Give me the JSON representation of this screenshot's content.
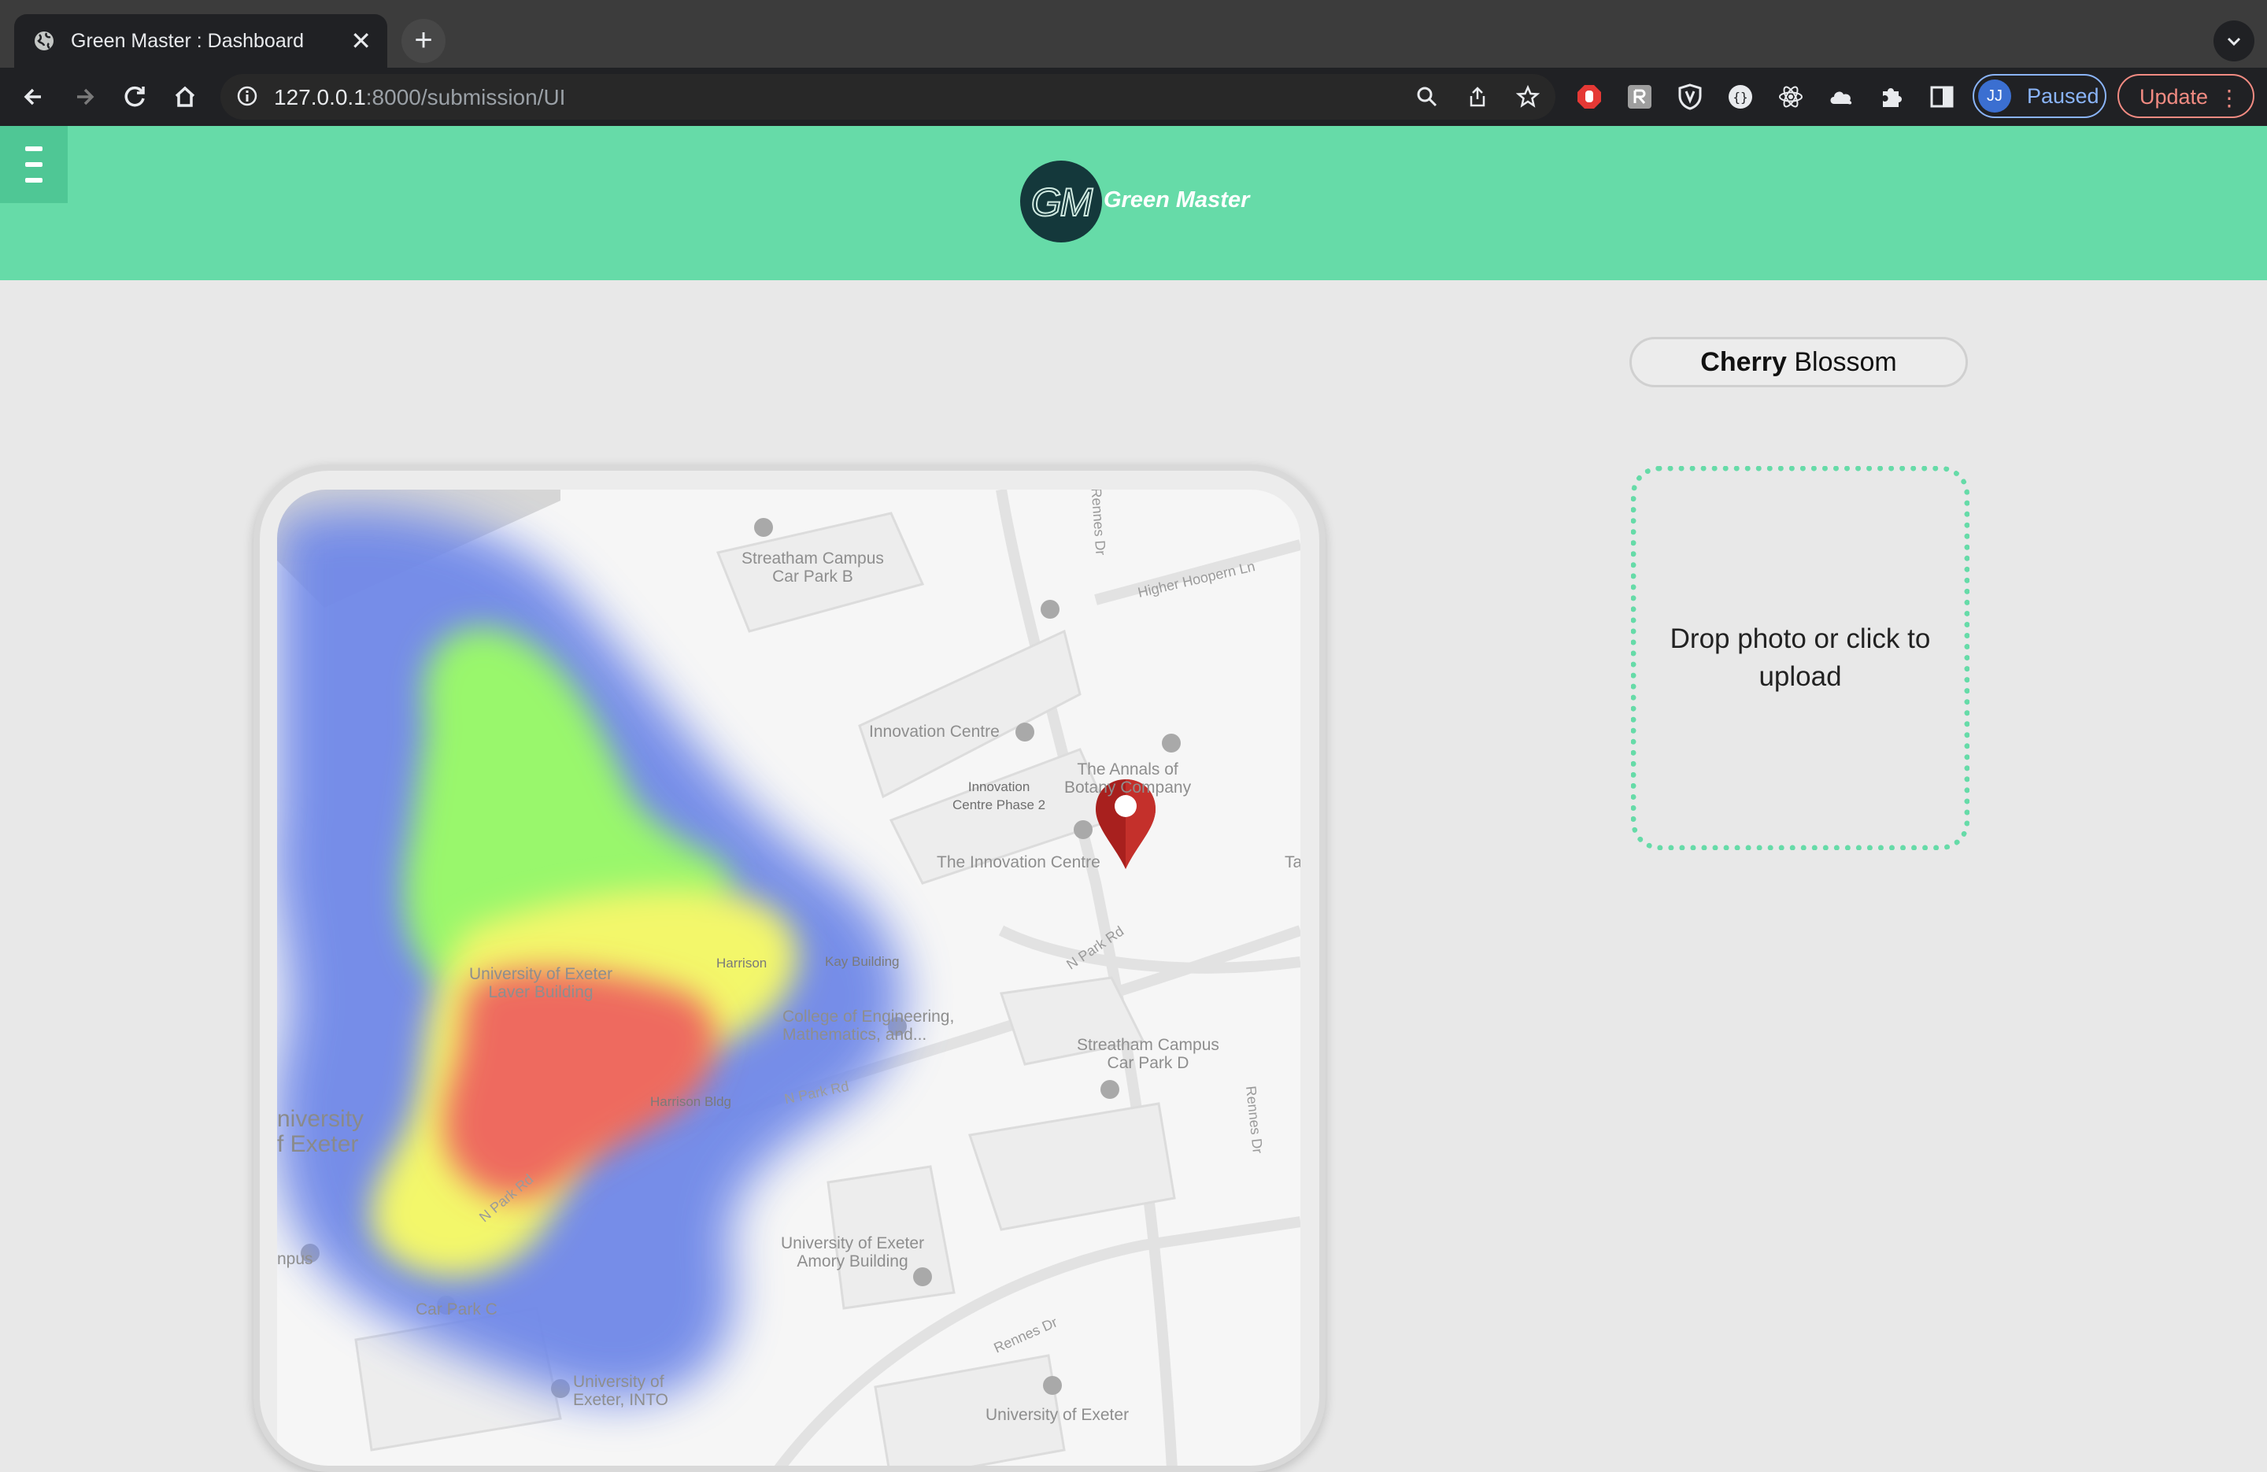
{
  "browser": {
    "tab_title": "Green Master : Dashboard",
    "tab_close": "✕",
    "new_tab": "+",
    "url_host": "127.0.0.1",
    "url_path": ":8000/submission/UI",
    "profile_initials": "JJ",
    "profile_status": "Paused",
    "update_label": "Update",
    "menu_dots": "⋮"
  },
  "header": {
    "logo_text": "GM",
    "brand_name": "Green Master",
    "accent_color": "#66dba8"
  },
  "plant": {
    "name_bold": "Cherry",
    "name_rest": " Blossom"
  },
  "upload": {
    "text": "Drop photo or click to upload"
  },
  "map": {
    "labels": {
      "car_park_b": "Streatham Campus\nCar Park B",
      "higher_hoopern": "Higher Hoopern Ln",
      "rennes_dr_top": "Rennes Dr",
      "innovation_centre": "Innovation Centre",
      "innovation_phase2": "Innovation\nCentre Phase 2",
      "annals": "The Annals of\nBotany Company",
      "the_innovation_centre": "The Innovation Centre",
      "ta": "Ta",
      "n_park_rd_1": "N Park Rd",
      "harrison": "Harrison",
      "kay_building": "Kay Building",
      "laver_building": "University of Exeter\nLaver Building",
      "college_eng": "College of Engineering,\nMathematics, and...",
      "car_park_d": "Streatham Campus\nCar Park D",
      "harrison_bldg": "Harrison Bldg",
      "n_park_rd_2": "N Park Rd",
      "rennes_dr_right": "Rennes Dr",
      "university_exeter": "niversity\nf Exeter",
      "n_park_rd_3": "N Park Rd",
      "amory": "University of Exeter\nAmory Building",
      "campus": "npus",
      "car_park_c": "Car Park C",
      "rennes_dr_bottom": "Rennes Dr",
      "into": "University of\nExeter, INTO",
      "uoe_bottom": "University of Exeter"
    },
    "heat_colors": [
      "#6f88e8",
      "#99f76c",
      "#f3f76b",
      "#ee6a5f"
    ],
    "marker_color": "#a8201e"
  }
}
